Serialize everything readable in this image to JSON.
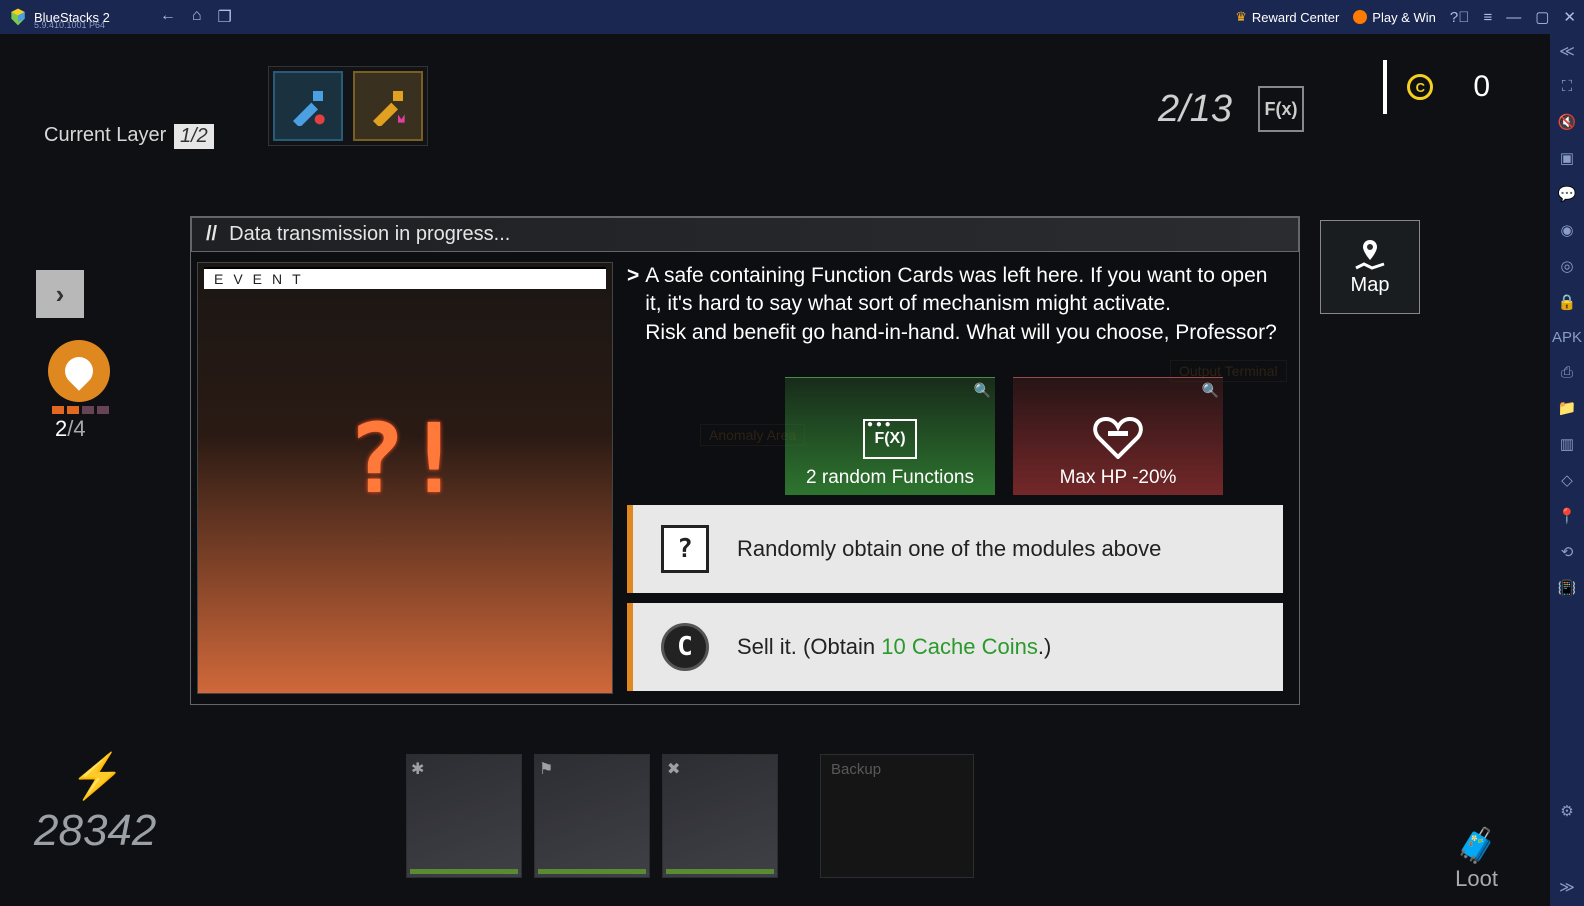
{
  "bluestacks": {
    "title": "BlueStacks 2",
    "version": "5.9.410.1001  P64",
    "reward_label": "Reward Center",
    "play_label": "Play & Win"
  },
  "hud": {
    "current_layer_label": "Current Layer",
    "current_layer_value": "1/2",
    "chip_count": "2/13",
    "fx_badge": "F(x)",
    "coin_value": "0",
    "resource_count_current": "2",
    "resource_count_max": "/4"
  },
  "dialog": {
    "header": "Data transmission in progress...",
    "event_tag": "EVENT",
    "event_glyph": "?!",
    "narrative": "A safe containing Function Cards was left here. If you want to open it, it's hard to say what sort of mechanism might activate.\nRisk and benefit go hand-in-hand. What will you choose, Professor?",
    "outcome_good": "2 random Functions",
    "outcome_good_icon": "F(X)",
    "outcome_bad": "Max HP -20%",
    "choice1": "Randomly obtain one of the modules above",
    "choice2_prefix": "Sell it. (Obtain ",
    "choice2_green": "10 Cache Coins",
    "choice2_suffix": ".)"
  },
  "map_label": "Map",
  "bg_nodes": {
    "anomaly": "Anomaly Area",
    "output": "Output Terminal"
  },
  "bottom": {
    "power": "28342",
    "backup_label": "Backup",
    "loot_label": "Loot"
  }
}
